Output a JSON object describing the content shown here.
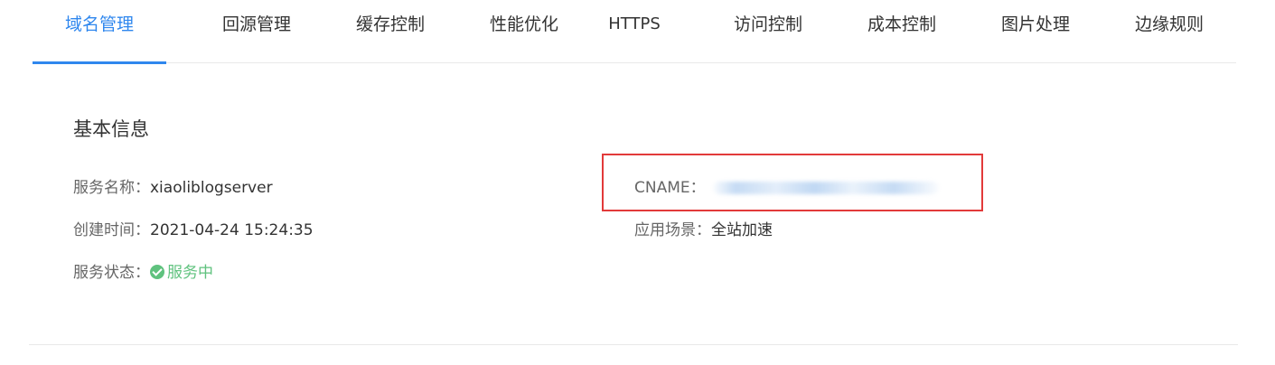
{
  "tabs": [
    {
      "label": "域名管理",
      "active": true
    },
    {
      "label": "回源管理"
    },
    {
      "label": "缓存控制"
    },
    {
      "label": "性能优化"
    },
    {
      "label": "HTTPS"
    },
    {
      "label": "访问控制"
    },
    {
      "label": "成本控制"
    },
    {
      "label": "图片处理"
    },
    {
      "label": "边缘规则"
    }
  ],
  "section": {
    "title": "基本信息"
  },
  "fields": {
    "service_name": {
      "label": "服务名称：",
      "value": "xiaoliblogserver"
    },
    "created_time": {
      "label": "创建时间：",
      "value": "2021-04-24 15:24:35"
    },
    "service_status": {
      "label": "服务状态：",
      "value": "服务中"
    },
    "cname": {
      "label": "CNAME："
    },
    "scenario": {
      "label": "应用场景：",
      "value": "全站加速"
    }
  },
  "colors": {
    "accent": "#2f87ee",
    "success": "#5fc27e",
    "highlight": "#e23a3a"
  },
  "icons": {
    "status": "check-circle-icon"
  }
}
